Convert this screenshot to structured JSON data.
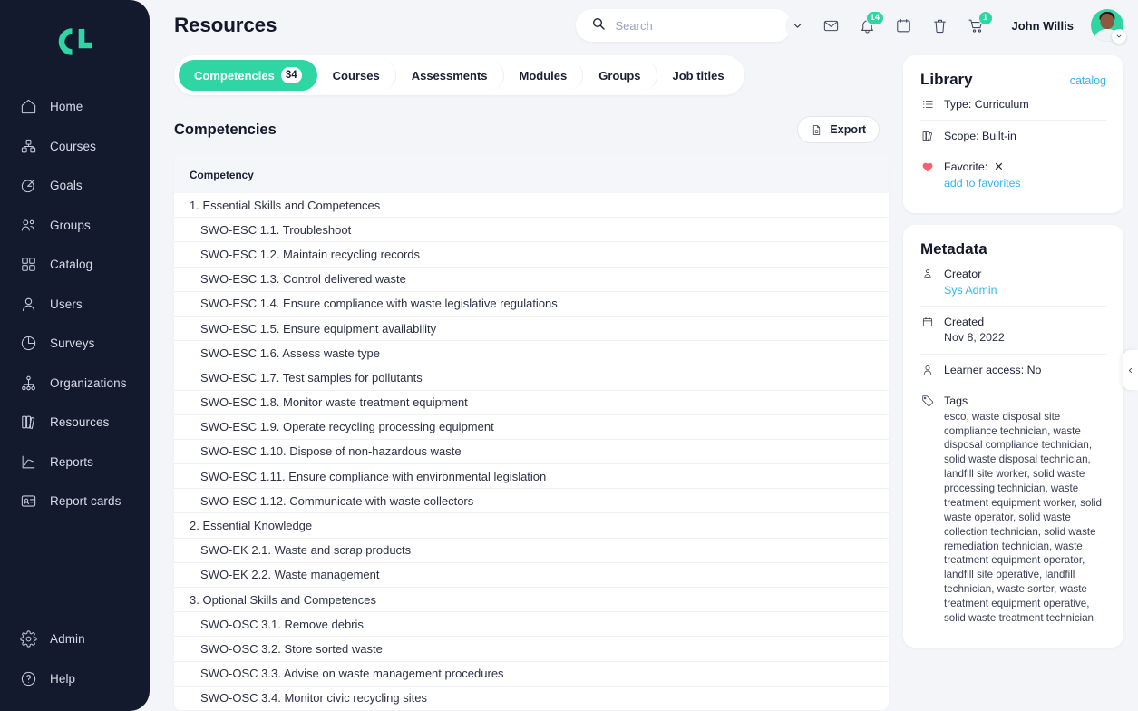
{
  "brand": {
    "logo_name": "cl-logo",
    "accent": "#2fd6a3",
    "sidebar_bg": "#141a2e",
    "link_blue": "#35b6ef"
  },
  "sidebar": {
    "items": [
      {
        "label": "Home",
        "icon": "home-icon"
      },
      {
        "label": "Courses",
        "icon": "courses-icon"
      },
      {
        "label": "Goals",
        "icon": "goals-icon"
      },
      {
        "label": "Groups",
        "icon": "groups-icon"
      },
      {
        "label": "Catalog",
        "icon": "catalog-icon"
      },
      {
        "label": "Users",
        "icon": "users-icon"
      },
      {
        "label": "Surveys",
        "icon": "surveys-icon"
      },
      {
        "label": "Organizations",
        "icon": "organizations-icon"
      },
      {
        "label": "Resources",
        "icon": "resources-icon"
      },
      {
        "label": "Reports",
        "icon": "reports-icon"
      },
      {
        "label": "Report cards",
        "icon": "report-cards-icon"
      }
    ],
    "bottom_items": [
      {
        "label": "Admin",
        "icon": "gear-icon"
      },
      {
        "label": "Help",
        "icon": "help-icon"
      }
    ]
  },
  "header": {
    "title": "Resources",
    "search": {
      "placeholder": "Search",
      "value": ""
    },
    "icons": [
      {
        "name": "mail-icon",
        "badge": ""
      },
      {
        "name": "bell-icon",
        "badge": "14"
      },
      {
        "name": "calendar-icon",
        "badge": ""
      },
      {
        "name": "trash-icon",
        "badge": ""
      },
      {
        "name": "cart-icon",
        "badge": "1"
      }
    ],
    "user_name": "John Willis"
  },
  "tabs": [
    {
      "label": "Competencies",
      "count": "34",
      "active": true
    },
    {
      "label": "Courses",
      "count": "",
      "active": false
    },
    {
      "label": "Assessments",
      "count": "",
      "active": false
    },
    {
      "label": "Modules",
      "count": "",
      "active": false
    },
    {
      "label": "Groups",
      "count": "",
      "active": false
    },
    {
      "label": "Job titles",
      "count": "",
      "active": false
    }
  ],
  "section": {
    "title": "Competencies",
    "export_label": "Export",
    "table_header": "Competency"
  },
  "competencies": [
    {
      "text": "1. Essential Skills and Competences",
      "level": "group"
    },
    {
      "text": "SWO-ESC 1.1. Troubleshoot",
      "level": "child"
    },
    {
      "text": "SWO-ESC 1.2. Maintain recycling records",
      "level": "child"
    },
    {
      "text": "SWO-ESC 1.3. Control delivered waste",
      "level": "child"
    },
    {
      "text": "SWO-ESC 1.4. Ensure compliance with waste legislative regulations",
      "level": "child"
    },
    {
      "text": "SWO-ESC 1.5. Ensure equipment availability",
      "level": "child"
    },
    {
      "text": "SWO-ESC 1.6. Assess waste type",
      "level": "child"
    },
    {
      "text": "SWO-ESC 1.7. Test samples for pollutants",
      "level": "child"
    },
    {
      "text": "SWO-ESC 1.8. Monitor waste treatment equipment",
      "level": "child"
    },
    {
      "text": "SWO-ESC 1.9. Operate recycling processing equipment",
      "level": "child"
    },
    {
      "text": "SWO-ESC 1.10. Dispose of non-hazardous waste",
      "level": "child"
    },
    {
      "text": "SWO-ESC 1.11. Ensure compliance with environmental legislation",
      "level": "child"
    },
    {
      "text": "SWO-ESC 1.12. Communicate with waste collectors",
      "level": "child"
    },
    {
      "text": "2. Essential Knowledge",
      "level": "group"
    },
    {
      "text": "SWO-EK 2.1. Waste and scrap products",
      "level": "child"
    },
    {
      "text": "SWO-EK 2.2. Waste management",
      "level": "child"
    },
    {
      "text": "3. Optional Skills and Competences",
      "level": "group"
    },
    {
      "text": "SWO-OSC 3.1. Remove debris",
      "level": "child"
    },
    {
      "text": "SWO-OSC 3.2. Store sorted waste",
      "level": "child"
    },
    {
      "text": "SWO-OSC 3.3. Advise on waste management procedures",
      "level": "child"
    },
    {
      "text": "SWO-OSC 3.4. Monitor civic recycling sites",
      "level": "child"
    }
  ],
  "library": {
    "title": "Library",
    "link_label": "catalog",
    "type_row": "Type: Curriculum",
    "scope_row": "Scope: Built-in",
    "favorite_label": "Favorite:",
    "favorite_value": "✕",
    "add_favorites_label": "add to favorites"
  },
  "metadata": {
    "title": "Metadata",
    "creator_label": "Creator",
    "creator_value": "Sys Admin",
    "created_label": "Created",
    "created_value": "Nov 8, 2022",
    "learner_access": "Learner access: No",
    "tags_label": "Tags",
    "tags_value": "esco, waste disposal site compliance technician, waste disposal compliance technician, solid waste disposal technician, landfill site worker, solid waste processing technician, waste treatment equipment worker, solid waste operator, solid waste collection technician, solid waste remediation technician, waste treatment equipment operator, landfill site operative, landfill technician, waste sorter, waste treatment equipment operative, solid waste treatment technician"
  }
}
